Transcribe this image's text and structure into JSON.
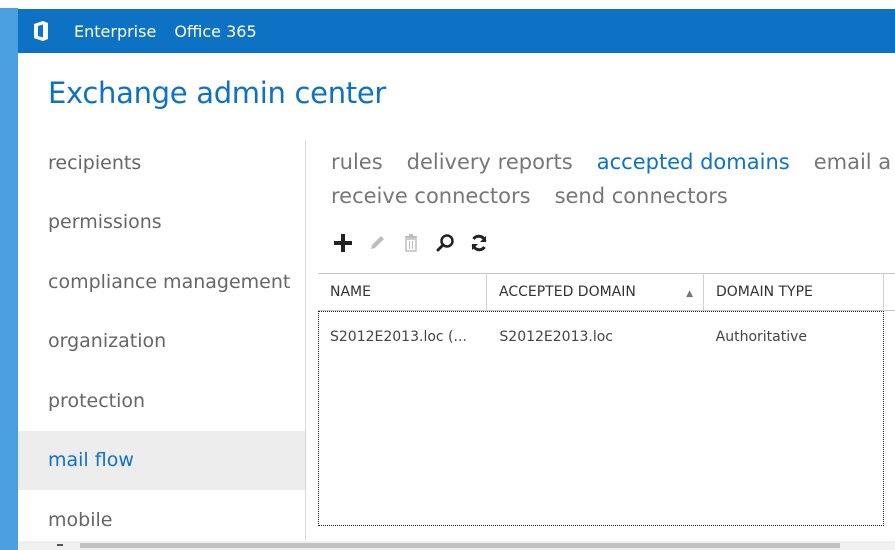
{
  "topbar": {
    "logo_icon": "office-logo-icon",
    "links": [
      "Enterprise",
      "Office 365"
    ],
    "background": "#0e72c4"
  },
  "app_title": "Exchange admin center",
  "nav": {
    "items": [
      {
        "label": "recipients"
      },
      {
        "label": "permissions"
      },
      {
        "label": "compliance management"
      },
      {
        "label": "organization"
      },
      {
        "label": "protection"
      },
      {
        "label": "mail flow",
        "selected": true
      },
      {
        "label": "mobile"
      }
    ]
  },
  "subtabs": {
    "row1": [
      "rules",
      "delivery reports",
      "accepted domains",
      "email a"
    ],
    "row2": [
      "receive connectors",
      "send connectors"
    ],
    "active": "accepted domains"
  },
  "toolbar": {
    "icons": [
      "add-icon",
      "edit-icon",
      "delete-icon",
      "search-icon",
      "refresh-icon"
    ]
  },
  "grid": {
    "columns": [
      "NAME",
      "ACCEPTED DOMAIN",
      "DOMAIN TYPE"
    ],
    "sorted_column": "ACCEPTED DOMAIN",
    "sort_direction": "ascending",
    "rows": [
      {
        "name": "S2012E2013.loc (...",
        "domain": "S2012E2013.loc",
        "type": "Authoritative"
      }
    ]
  },
  "colors": {
    "accent": "#0e72c4",
    "frame": "#4a9fe0",
    "selected_nav_bg": "#ededed"
  }
}
